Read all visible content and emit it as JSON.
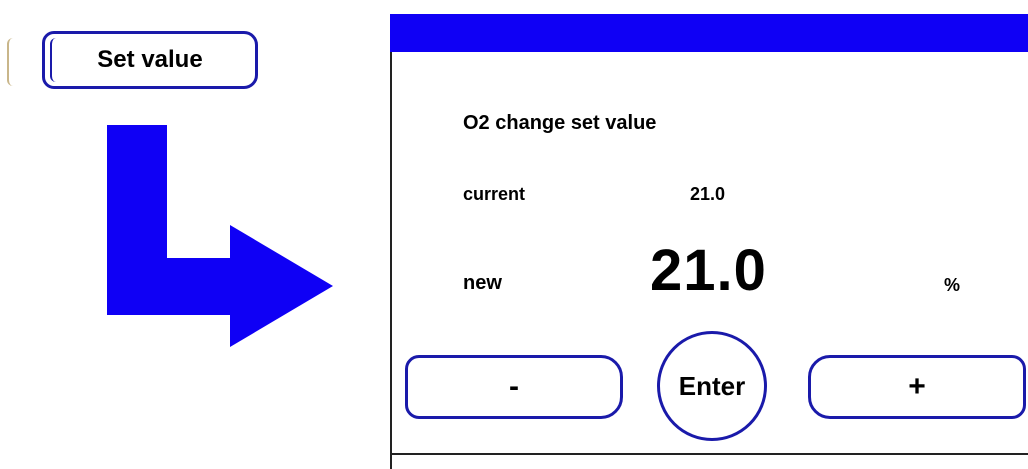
{
  "left_panel": {
    "set_value_label": "Set value"
  },
  "screen": {
    "title": "O2 change set value",
    "current_label": "current",
    "current_value": "21.0",
    "new_label": "new",
    "new_value": "21.0",
    "unit": "%"
  },
  "buttons": {
    "minus_label": "-",
    "enter_label": "Enter",
    "plus_label": "+"
  },
  "colors": {
    "accent_blue": "#0f00f5",
    "button_outline": "#1a1aaa"
  },
  "icons": {
    "arrow": "arrow-down-right-icon"
  }
}
